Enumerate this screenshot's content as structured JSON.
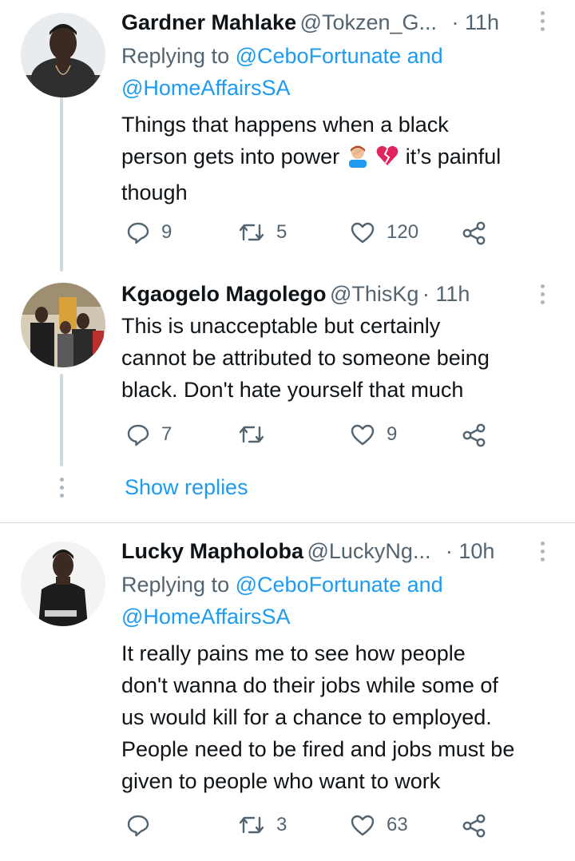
{
  "tweets": [
    {
      "name": "Gardner Mahlake",
      "handle": "@Tokzen_G...",
      "time": "· 11h",
      "replying_prefix": "Replying to",
      "replying_to": "@CeboFortunate and",
      "replying_to_2": "@HomeAffairsSA",
      "text_line1": "Things that happens when a black",
      "text_line2a": "person gets into power",
      "text_line2b": "it’s painful",
      "text_line3": "though",
      "replies": "9",
      "retweets": "5",
      "likes": "120"
    },
    {
      "name": "Kgaogelo Magolego",
      "handle": "@ThisKg",
      "time": "· 11h",
      "text_line1": "This is unacceptable but certainly",
      "text_line2": "cannot be attributed to someone being",
      "text_line3": "black. Don't hate yourself that much",
      "replies": "7",
      "retweets": "",
      "likes": "9"
    },
    {
      "name": "Lucky Mapholoba",
      "handle": "@LuckyNg...",
      "time": "· 10h",
      "replying_prefix": "Replying to",
      "replying_to": "@CeboFortunate and",
      "replying_to_2": "@HomeAffairsSA",
      "text_line1": "It really pains me to see how people",
      "text_line2": "don't wanna do their jobs while some of",
      "text_line3": "us would kill for a chance to employed.",
      "text_line4": "People need to be fired and jobs must be",
      "text_line5": "given to people who want to work",
      "replies": "",
      "retweets": "3",
      "likes": "63"
    }
  ],
  "show_replies": "Show replies",
  "colors": {
    "link": "#1d9bf0",
    "secondary": "#536471",
    "divider": "#cfd9de"
  },
  "icons": [
    "reply-icon",
    "retweet-icon",
    "like-icon",
    "share-icon",
    "more-icon",
    "facepalm-emoji",
    "broken-heart-emoji"
  ]
}
